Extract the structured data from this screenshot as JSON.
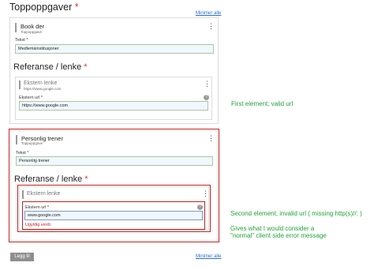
{
  "page": {
    "title": "Toppoppgaver",
    "required_mark": "*",
    "minimize_all": "Minimer alle",
    "add_button": "Legg til"
  },
  "card1": {
    "title": "Book der",
    "subtitle": "Toppoppgave",
    "text_label": "Tekst *",
    "text_value": "Medlemsinstitusjoner",
    "section_heading": "Referanse / lenke",
    "ext_title": "Ekstern lenke",
    "ext_subtitle": "https://www.google.com",
    "url_label": "Ekstern url *",
    "url_value": "https://www.google.com"
  },
  "card2": {
    "title": "Personlig trener",
    "subtitle": "Toppoppgave",
    "text_label": "Tekst *",
    "text_value": "Personlig trener",
    "section_heading": "Referanse / lenke",
    "ext_title": "Ekstern lenke",
    "url_label": "Ekstern url *",
    "url_value": "www.google.com",
    "error": "Ugyldig verdi"
  },
  "annotations": {
    "first": "First element; valid url",
    "second": "Second element, invalid url ( missing http(s)//: )",
    "third_line1": "Gives what I would consider a",
    "third_line2": "\"normal\" client side error message"
  },
  "icons": {
    "kebab": "kebab-menu-icon",
    "help": "help-icon"
  },
  "colors": {
    "required": "#d9352f",
    "error": "#cc1f1f",
    "annotation": "#22a33a",
    "link": "#2a6fd6"
  }
}
